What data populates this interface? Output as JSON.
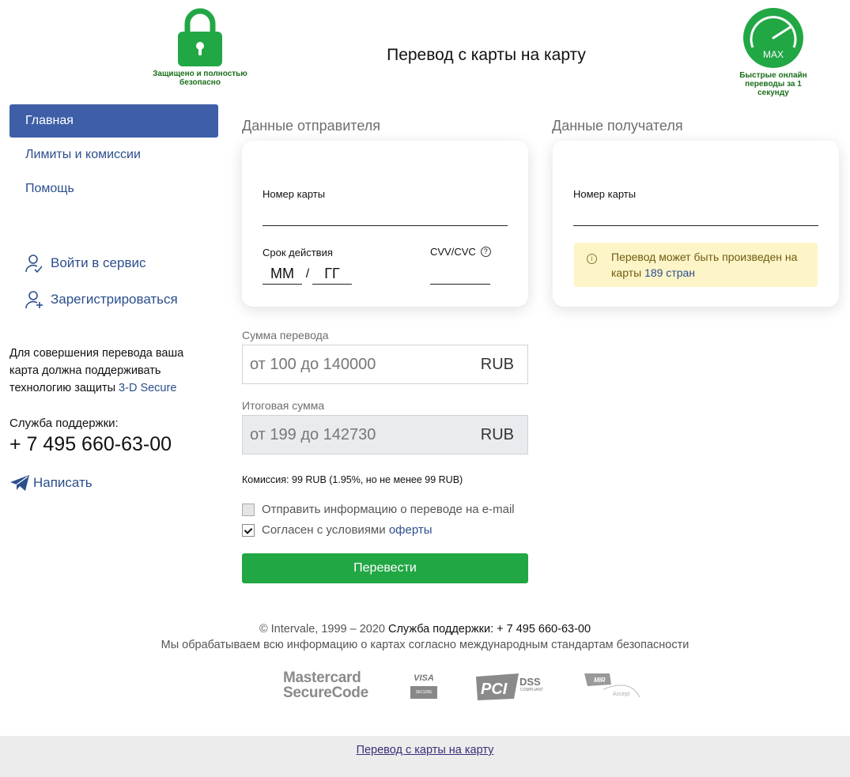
{
  "header": {
    "title": "Перевод с карты на карту",
    "secure_caption": "Защищено и полностью безопасно",
    "fast_caption": "Быстрые онлайн переводы за 1 секунду",
    "speed_label": "MAX",
    "accent_color": "#22a745"
  },
  "sidebar": {
    "nav": [
      {
        "label": "Главная",
        "active": true
      },
      {
        "label": "Лимиты и комиссии"
      },
      {
        "label": "Помощь"
      }
    ],
    "login_label": "Войти в сервис",
    "register_label": "Зарегистрироваться",
    "secure_note": "Для совершения перевода ваша карта должна поддерживать технологию защиты",
    "secure_link": "3-D Secure",
    "support_label": "Служба поддержки:",
    "support_phone": "+ 7 495 660-63-00",
    "write_label": "Написать"
  },
  "sender": {
    "heading": "Данные отправителя",
    "card_number_label": "Номер карты",
    "expiry_label": "Срок действия",
    "month_placeholder": "ММ",
    "separator": "/",
    "year_placeholder": "ГГ",
    "cvv_label": "CVV/CVC",
    "help": "?"
  },
  "recipient": {
    "heading": "Данные получателя",
    "card_number_label": "Номер карты",
    "notice_icon": "i",
    "notice_text": "Перевод может быть произведен на карты",
    "notice_link": "189 стран"
  },
  "amount": {
    "label": "Сумма перевода",
    "placeholder": "от 100 до 140000",
    "currency": "RUB"
  },
  "total": {
    "label": "Итоговая сумма",
    "placeholder": "от 199 до 142730",
    "currency": "RUB"
  },
  "commission": "Комиссия: 99 RUB (1.95%, но не менее 99 RUB)",
  "options": {
    "email_label": "Отправить информацию о переводе на e-mail",
    "email_checked": false,
    "agree_label": "Согласен с условиями",
    "agree_link": "оферты",
    "agree_checked": true
  },
  "submit_label": "Перевести",
  "footer": {
    "copyright": "© Intervale, 1999 – 2020",
    "support": "Служба поддержки: + 7 495 660-63-00",
    "security_note": "Мы обрабатываем всю информацию о картах согласно международным стандартам безопасности",
    "logos": {
      "mastercard_line1": "Mastercard",
      "mastercard_line2": "SecureCode",
      "visa": "VISA",
      "visa_sub": "SECURE",
      "pci": "PCI",
      "dss": "DSS",
      "dss_sub": "COMPLIANT",
      "mir": "MIR",
      "mir_sub": "Accept"
    },
    "bottom_link": "Перевод с карты на карту"
  }
}
